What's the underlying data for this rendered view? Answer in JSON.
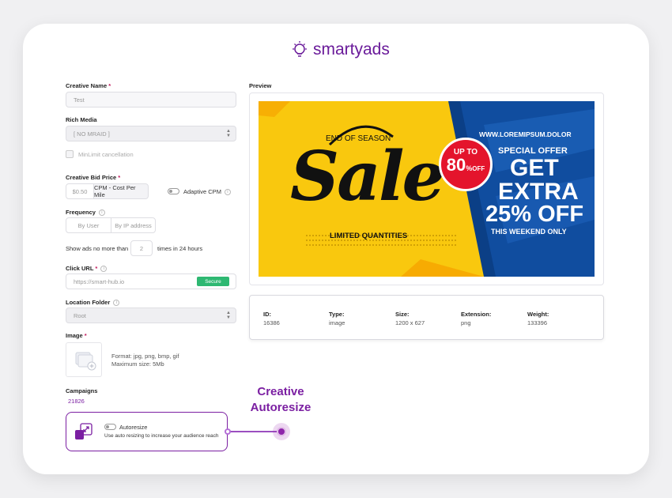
{
  "brand": {
    "name": "smartyads"
  },
  "form": {
    "creative_name": {
      "label": "Creative Name",
      "required": "*",
      "value": "Test"
    },
    "rich_media": {
      "label": "Rich Media",
      "value": "[ NO MRAID ]"
    },
    "minlimit": {
      "label": "MinLimit cancellation"
    },
    "bid_price": {
      "label": "Creative Bid Price",
      "required": "*",
      "value": "$0.50",
      "model": "CPM - Cost Per Mile",
      "adaptive_label": "Adaptive CPM"
    },
    "frequency": {
      "label": "Frequency",
      "options": [
        "By User",
        "By IP address"
      ]
    },
    "show_ads": {
      "prefix": "Show ads no more than",
      "value": "2",
      "suffix": "times in 24 hours"
    },
    "click_url": {
      "label": "Click URL",
      "required": "*",
      "value": "https://smart-hub.io",
      "badge": "Secure"
    },
    "location_folder": {
      "label": "Location Folder",
      "value": "Root"
    },
    "image": {
      "label": "Image",
      "required": "*",
      "formats": "Format: jpg, png, bmp, gif",
      "max_size": "Maximum size: 5Mb"
    },
    "campaigns": {
      "label": "Campaigns",
      "value": "21826"
    },
    "autoresize": {
      "title": "Autoresize",
      "description": "Use auto resizing to increase your audience reach"
    }
  },
  "preview": {
    "label": "Preview",
    "banner": {
      "end_of_season": "END OF SEASON",
      "sale": "Sale",
      "limited": "LIMITED QUANTITIES",
      "up_to": "UP TO",
      "percent": "80",
      "pct_sign": "%",
      "off": "OFF",
      "website": "WWW.LOREMIPSUM.DOLOR",
      "special_offer": "SPECIAL OFFER",
      "get": "GET",
      "extra": "EXTRA",
      "off_25": "25% OFF",
      "weekend": "THIS WEEKEND ONLY",
      "colors": {
        "yellow": "#f9c80e",
        "blue": "#0d4c9c",
        "red": "#e4142c"
      }
    }
  },
  "meta": {
    "id": {
      "label": "ID:",
      "value": "16386"
    },
    "type": {
      "label": "Type:",
      "value": "image"
    },
    "size": {
      "label": "Size:",
      "value": "1200 x 627"
    },
    "extension": {
      "label": "Extension:",
      "value": "png"
    },
    "weight": {
      "label": "Weight:",
      "value": "133396"
    }
  },
  "callout": {
    "line1": "Creative",
    "line2": "Autoresize"
  },
  "colors": {
    "accent": "#7b1fa2",
    "secure": "#2eb872",
    "required": "#c2185b"
  }
}
